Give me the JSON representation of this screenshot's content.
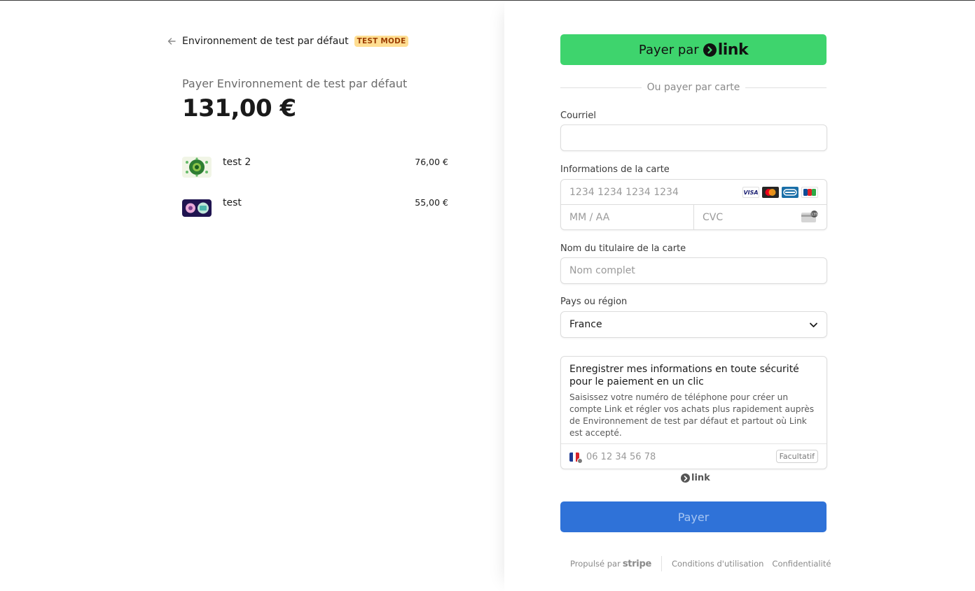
{
  "summary": {
    "merchant_name": "Environnement de test par défaut",
    "badge": "TEST MODE",
    "pay_title": "Payer Environnement de test par défaut",
    "total": "131,00 €",
    "items": [
      {
        "name": "test 2",
        "price": "76,00 €"
      },
      {
        "name": "test",
        "price": "55,00 €"
      }
    ]
  },
  "checkout": {
    "link_button": {
      "label": "Payer par",
      "brand": "link"
    },
    "divider_text": "Ou payer par carte",
    "email": {
      "label": "Courriel",
      "value": "",
      "placeholder": ""
    },
    "card": {
      "label": "Informations de la carte",
      "number_placeholder": "1234 1234 1234 1234",
      "expiry_placeholder": "MM / AA",
      "cvc_placeholder": "CVC",
      "brands": [
        "visa-icon",
        "mastercard-icon",
        "cb-icon",
        "jcb-icon"
      ],
      "visa_text": "VISA",
      "cvc_icon_text": "135"
    },
    "cardholder": {
      "label": "Nom du titulaire de la carte",
      "placeholder": "Nom complet"
    },
    "country": {
      "label": "Pays ou région",
      "value": "France"
    },
    "save_info": {
      "title": "Enregistrer mes informations en toute sécurité pour le paiement en un clic",
      "description": "Saisissez votre numéro de téléphone pour créer un compte Link et régler vos achats plus rapidement auprès de Environnement de test par défaut et partout où Link est accepté.",
      "phone_placeholder": "06 12 34 56 78",
      "optional_label": "Facultatif"
    },
    "link_small": "link",
    "pay_button": "Payer",
    "footer": {
      "powered_by": "Propulsé par",
      "stripe": "stripe",
      "terms": "Conditions d'utilisation",
      "privacy": "Confidentialité"
    }
  },
  "colors": {
    "link_green": "#3ed46d",
    "pay_blue": "#2f72d8",
    "badge_bg": "#ffde92",
    "badge_text": "#9c3e03"
  }
}
